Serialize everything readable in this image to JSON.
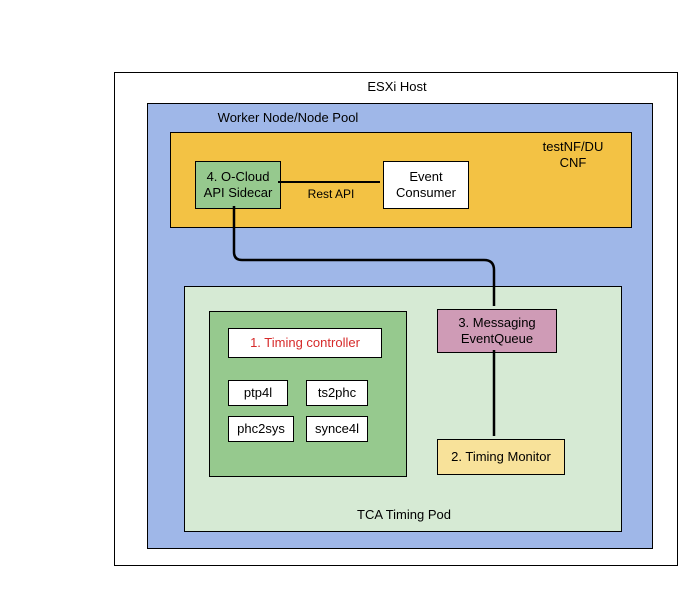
{
  "host": {
    "title": "ESXi Host"
  },
  "worker": {
    "title": "Worker Node/Node Pool"
  },
  "cnf": {
    "title": "testNF/DU\nCNF",
    "sidecar": "4. O-Cloud\nAPI Sidecar",
    "consumer": "Event\nConsumer",
    "rest_api": "Rest API"
  },
  "timing_pod": {
    "title": "TCA Timing Pod",
    "controller": "1. Timing controller",
    "ptp4l": "ptp4l",
    "ts2phc": "ts2phc",
    "phc2sys": "phc2sys",
    "synce4l": "synce4l",
    "messaging": "3. Messaging\nEventQueue",
    "monitor": "2. Timing Monitor"
  },
  "colors": {
    "worker_bg": "#9fb7e8",
    "cnf_bg": "#f3c244",
    "sidecar_bg": "#96c98e",
    "pod_bg": "#d6ead4",
    "inner_green": "#96c98e",
    "messaging_bg": "#cf9bb6",
    "monitor_bg": "#f8e29a"
  }
}
